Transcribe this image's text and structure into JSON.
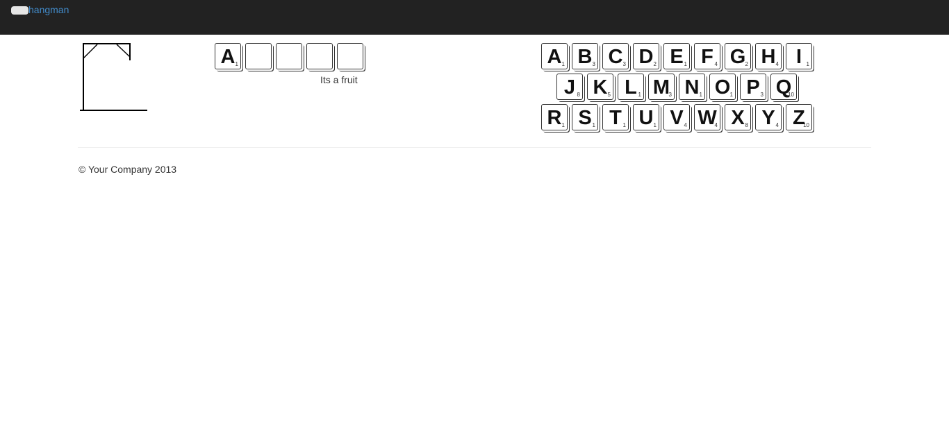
{
  "navbar": {
    "brand": "hangman",
    "toggle_icon": "menu-toggle-icon"
  },
  "word": {
    "slots": [
      {
        "letter": "A",
        "score": "1"
      },
      {
        "letter": "",
        "score": ""
      },
      {
        "letter": "",
        "score": ""
      },
      {
        "letter": "",
        "score": ""
      },
      {
        "letter": "",
        "score": ""
      }
    ],
    "hint": "Its a fruit"
  },
  "keyboard": {
    "rows": [
      [
        {
          "letter": "A",
          "score": "1"
        },
        {
          "letter": "B",
          "score": "3"
        },
        {
          "letter": "C",
          "score": "3"
        },
        {
          "letter": "D",
          "score": "2"
        },
        {
          "letter": "E",
          "score": "1"
        },
        {
          "letter": "F",
          "score": "4"
        },
        {
          "letter": "G",
          "score": "2"
        },
        {
          "letter": "H",
          "score": "4"
        },
        {
          "letter": "I",
          "score": "1"
        }
      ],
      [
        {
          "letter": "J",
          "score": "8"
        },
        {
          "letter": "K",
          "score": "5"
        },
        {
          "letter": "L",
          "score": "1"
        },
        {
          "letter": "M",
          "score": "3"
        },
        {
          "letter": "N",
          "score": "1"
        },
        {
          "letter": "O",
          "score": "1"
        },
        {
          "letter": "P",
          "score": "3"
        },
        {
          "letter": "Q",
          "score": "10"
        }
      ],
      [
        {
          "letter": "R",
          "score": "1"
        },
        {
          "letter": "S",
          "score": "1"
        },
        {
          "letter": "T",
          "score": "1"
        },
        {
          "letter": "U",
          "score": "1"
        },
        {
          "letter": "V",
          "score": "4"
        },
        {
          "letter": "W",
          "score": "4"
        },
        {
          "letter": "X",
          "score": "8"
        },
        {
          "letter": "Y",
          "score": "4"
        },
        {
          "letter": "Z",
          "score": "10"
        }
      ]
    ]
  },
  "footer": {
    "text": "© Your Company 2013"
  }
}
